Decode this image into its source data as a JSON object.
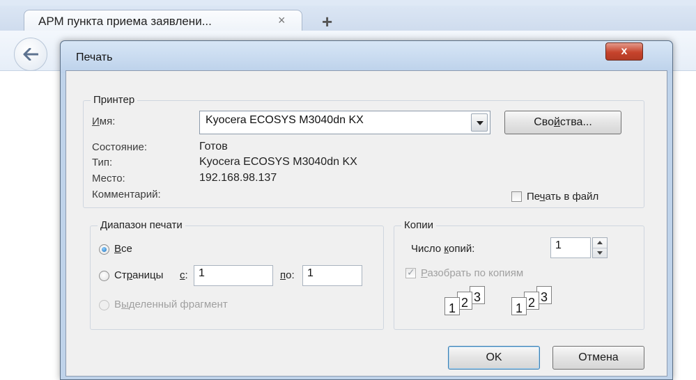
{
  "browser": {
    "tab_title": "АРМ пункта приема заявлени...",
    "tab_close": "×",
    "new_tab": "+"
  },
  "dialog": {
    "title": "Печать",
    "close_glyph": "x",
    "printer": {
      "legend": "Принтер",
      "name_label": {
        "pre": "",
        "u": "И",
        "post": "мя:"
      },
      "name_value": "Kyocera ECOSYS M3040dn KX",
      "properties_button": {
        "pre": "Сво",
        "u": "й",
        "post": "ства..."
      },
      "status_label": "Состояние:",
      "status_value": "Готов",
      "type_label": "Тип:",
      "type_value": "Kyocera ECOSYS M3040dn KX",
      "location_label": "Место:",
      "location_value": "192.168.98.137",
      "comment_label": "Комментарий:",
      "comment_value": "",
      "print_to_file": {
        "pre": "Пе",
        "u": "ч",
        "post": "ать в файл",
        "checked": false
      }
    },
    "range": {
      "legend": "Диапазон печати",
      "all": {
        "pre": "",
        "u": "В",
        "post": "се",
        "selected": true
      },
      "pages": {
        "pre": "Ст",
        "u": "р",
        "post": "аницы",
        "selected": false
      },
      "from_label": {
        "u": "с",
        "post": ":"
      },
      "from_value": "1",
      "to_label": {
        "u": "п",
        "post": "о:"
      },
      "to_value": "1",
      "selection": {
        "pre": "В",
        "u": "ы",
        "post": "деленный фрагмент",
        "enabled": false
      }
    },
    "copies": {
      "legend": "Копии",
      "count_label": {
        "pre": "Число ",
        "u": "к",
        "post": "опий:"
      },
      "count_value": "1",
      "collate": {
        "pre": "",
        "u": "Р",
        "post": "азобрать по копиям",
        "checked": true,
        "enabled": false
      },
      "collate_pages": [
        "1",
        "2",
        "3"
      ]
    },
    "ok_button": "OK",
    "cancel_button": "Отмена"
  },
  "colors": {
    "dialog_frame": "#bfd3ea",
    "close_button": "#c6432c",
    "default_button_border": "#3c7fb1"
  }
}
